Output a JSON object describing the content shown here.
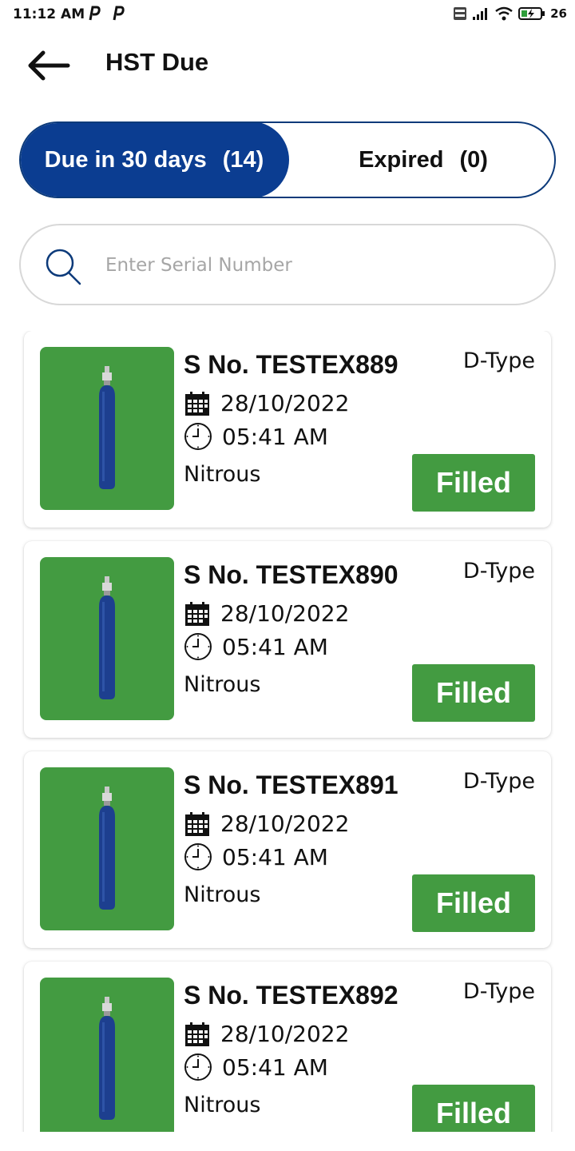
{
  "status_bar": {
    "time": "11:12 AM",
    "battery": "26",
    "icons": [
      "parking-icon",
      "parking-icon",
      "volte-icon",
      "signal-icon",
      "wifi-icon",
      "battery-charging-icon"
    ]
  },
  "header": {
    "title": "HST Due",
    "back_icon": "arrow-left-icon"
  },
  "tabs": [
    {
      "label": "Due in 30 days",
      "count": "(14)",
      "active": true
    },
    {
      "label": "Expired",
      "count": "(0)",
      "active": false
    }
  ],
  "search": {
    "placeholder": "Enter Serial Number",
    "value": ""
  },
  "colors": {
    "primary": "#0b3d91",
    "accent_green": "#439b41",
    "border": "#d8d8d8"
  },
  "items": [
    {
      "serial": "S No. TESTEX889",
      "type": "D-Type",
      "date": "28/10/2022",
      "time": "05:41 AM",
      "gas": "Nitrous",
      "status": "Filled"
    },
    {
      "serial": "S No. TESTEX890",
      "type": "D-Type",
      "date": "28/10/2022",
      "time": "05:41 AM",
      "gas": "Nitrous",
      "status": "Filled"
    },
    {
      "serial": "S No. TESTEX891",
      "type": "D-Type",
      "date": "28/10/2022",
      "time": "05:41 AM",
      "gas": "Nitrous",
      "status": "Filled"
    },
    {
      "serial": "S No. TESTEX892",
      "type": "D-Type",
      "date": "28/10/2022",
      "time": "05:41 AM",
      "gas": "Nitrous",
      "status": "Filled"
    }
  ]
}
